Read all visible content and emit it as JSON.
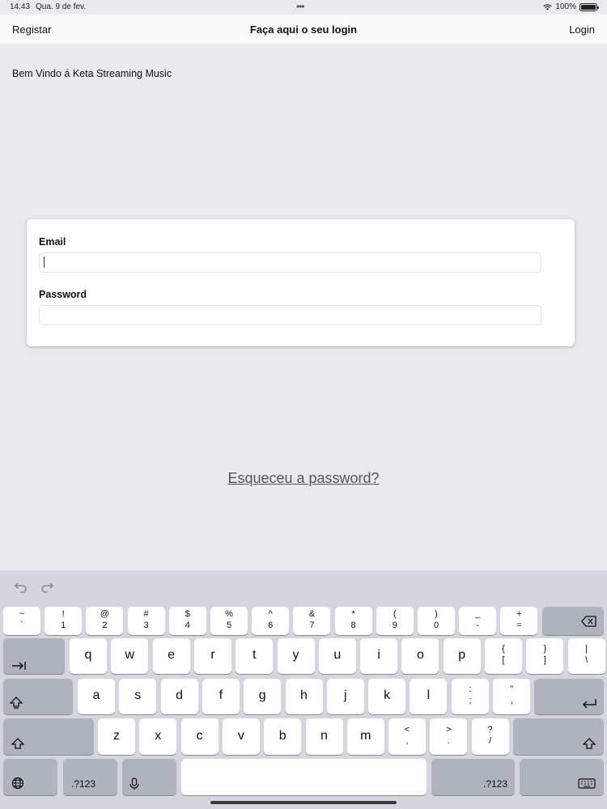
{
  "status_bar": {
    "time": "14:43",
    "date": "Qua. 9 de fev.",
    "battery": "100%"
  },
  "nav": {
    "left": "Registar",
    "title": "Faça aqui o seu login",
    "right": "Login"
  },
  "welcome": "Bem Vindo á Keta Streaming Music",
  "form": {
    "email_label": "Email",
    "email_value": "",
    "password_label": "Password",
    "password_value": ""
  },
  "forgot_password": "Esqueceu a password?",
  "keyboard": {
    "row1": [
      {
        "top": "~",
        "bottom": "`"
      },
      {
        "top": "!",
        "bottom": "1"
      },
      {
        "top": "@",
        "bottom": "2"
      },
      {
        "top": "#",
        "bottom": "3"
      },
      {
        "top": "$",
        "bottom": "4"
      },
      {
        "top": "%",
        "bottom": "5"
      },
      {
        "top": "^",
        "bottom": "6"
      },
      {
        "top": "&",
        "bottom": "7"
      },
      {
        "top": "*",
        "bottom": "8"
      },
      {
        "top": "(",
        "bottom": "9"
      },
      {
        "top": ")",
        "bottom": "0"
      },
      {
        "top": "_",
        "bottom": "-"
      },
      {
        "top": "+",
        "bottom": "="
      }
    ],
    "row2": [
      "q",
      "w",
      "e",
      "r",
      "t",
      "y",
      "u",
      "i",
      "o",
      "p"
    ],
    "row2_extra": [
      {
        "top": "{",
        "bottom": "["
      },
      {
        "top": "}",
        "bottom": "]"
      },
      {
        "top": "|",
        "bottom": "\\"
      }
    ],
    "row3": [
      "a",
      "s",
      "d",
      "f",
      "g",
      "h",
      "j",
      "k",
      "l"
    ],
    "row3_extra": [
      {
        "top": ":",
        "bottom": ";"
      },
      {
        "top": "\"",
        "bottom": ","
      }
    ],
    "row4": [
      "z",
      "x",
      "c",
      "v",
      "b",
      "n",
      "m"
    ],
    "row4_extra": [
      {
        "top": "<",
        "bottom": ","
      },
      {
        "top": ">",
        "bottom": "."
      },
      {
        "top": "?",
        "bottom": "/"
      }
    ],
    "numbers_label": ".?123",
    "numbers_label_right": ".?123"
  }
}
